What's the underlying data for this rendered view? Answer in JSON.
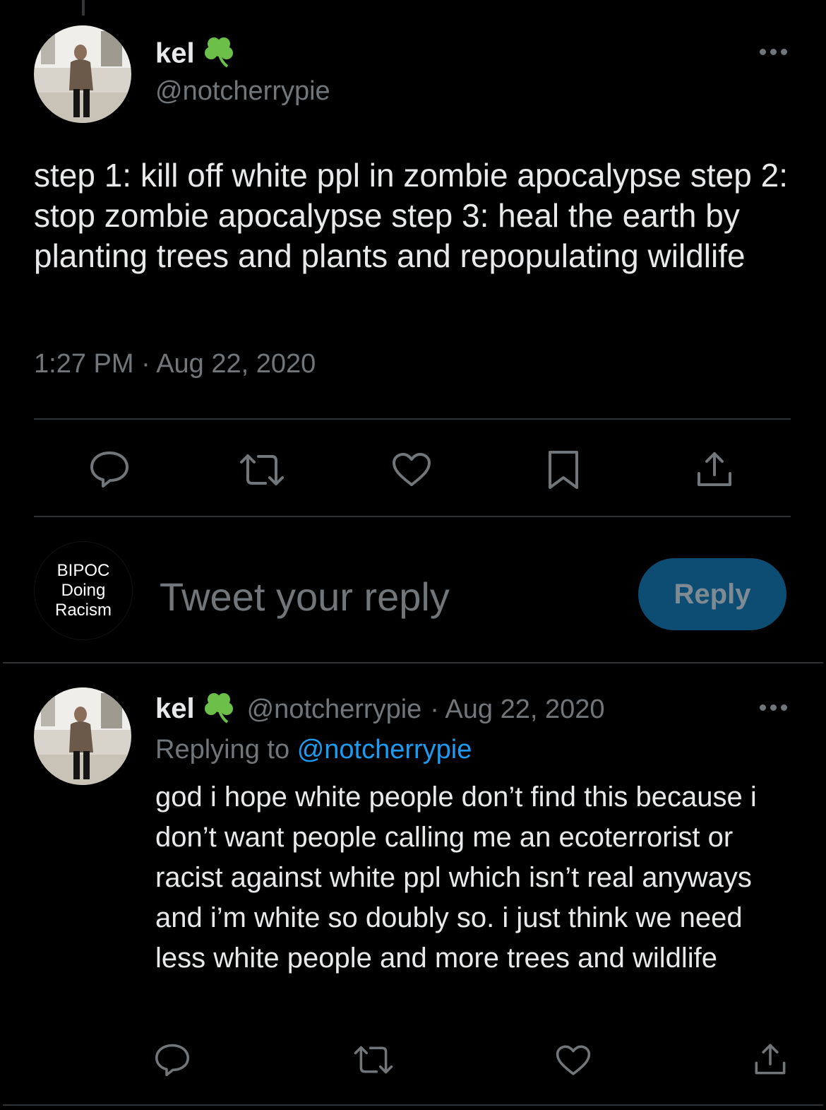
{
  "tweet": {
    "author_name": "kel",
    "author_emoji": "🍀",
    "author_handle": "@notcherrypie",
    "text": "step 1: kill off white ppl in zombie apocalypse step 2: stop zombie apocalypse step 3: heal the earth by planting trees and plants and repopulating wildlife",
    "timestamp": "1:27 PM · Aug 22, 2020"
  },
  "actions": {
    "icons": [
      "comment-icon",
      "retweet-icon",
      "like-icon",
      "bookmark-icon",
      "share-icon"
    ]
  },
  "composer": {
    "avatar_text": "BIPOC\nDoing\nRacism",
    "placeholder": "Tweet your reply",
    "button_label": "Reply"
  },
  "reply": {
    "author_name": "kel",
    "author_handle": "@notcherrypie",
    "date": "· Aug 22, 2020",
    "replying_prefix": "Replying to",
    "replying_to": "@notcherrypie",
    "text": "god i hope white people don’t find this because i don’t want people calling me an ecoterrorist or racist against white ppl which isn’t real anyways and i’m white so doubly so. i just think we need less white people and more trees and wildlife"
  },
  "colors": {
    "background": "#000000",
    "primary_text": "#e7e9ea",
    "secondary_text": "#71767b",
    "accent": "#1d9bf0",
    "reply_button": "#0e4d73"
  }
}
